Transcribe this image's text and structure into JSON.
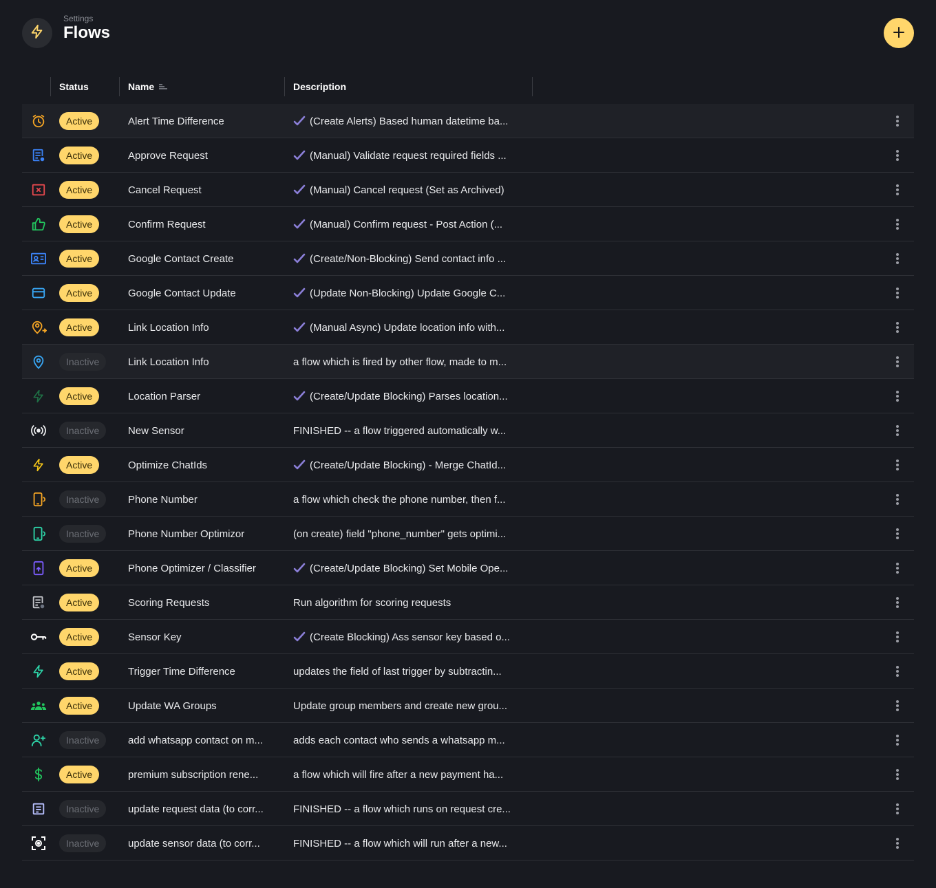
{
  "header": {
    "subtitle": "Settings",
    "title": "Flows",
    "icon": "bolt-icon",
    "add_button_icon": "plus-icon"
  },
  "columns": {
    "status": "Status",
    "name": "Name",
    "description": "Description"
  },
  "colors": {
    "accent": "#ffd66b",
    "background": "#181a20",
    "check": "#8b7fd8"
  },
  "rows": [
    {
      "icon": "alarm-clock-icon",
      "icon_color": "#f5a524",
      "status": "Active",
      "name": "Alert Time Difference",
      "desc": "(Create Alerts) Based human datetime ba...",
      "checked": true,
      "highlight": true
    },
    {
      "icon": "document-check-icon",
      "icon_color": "#3b82f6",
      "status": "Active",
      "name": "Approve Request",
      "desc": "(Manual) Validate request required fields ...",
      "checked": true
    },
    {
      "icon": "close-box-icon",
      "icon_color": "#e5484d",
      "status": "Active",
      "name": "Cancel Request",
      "desc": "(Manual) Cancel request (Set as Archived)",
      "checked": true
    },
    {
      "icon": "thumbs-up-icon",
      "icon_color": "#22c55e",
      "status": "Active",
      "name": "Confirm Request",
      "desc": "(Manual) Confirm request - Post Action (...",
      "checked": true
    },
    {
      "icon": "contact-card-icon",
      "icon_color": "#3b82f6",
      "status": "Active",
      "name": "Google Contact Create",
      "desc": "(Create/Non-Blocking) Send contact info ...",
      "checked": true
    },
    {
      "icon": "credit-card-icon",
      "icon_color": "#38a7f5",
      "status": "Active",
      "name": "Google Contact Update",
      "desc": "(Update Non-Blocking) Update Google C...",
      "checked": true
    },
    {
      "icon": "location-user-icon",
      "icon_color": "#f5a524",
      "status": "Active",
      "name": "Link Location Info",
      "desc": "(Manual Async) Update location info with...",
      "checked": true
    },
    {
      "icon": "map-pin-icon",
      "icon_color": "#38a7f5",
      "status": "Inactive",
      "name": "Link Location Info",
      "desc": "a flow which is fired by other flow, made to m...",
      "checked": false,
      "highlight": true
    },
    {
      "icon": "bolt-icon",
      "icon_color": "#1f6f45",
      "status": "Active",
      "name": "Location Parser",
      "desc": "(Create/Update Blocking) Parses location...",
      "checked": true
    },
    {
      "icon": "broadcast-icon",
      "icon_color": "#e9eaec",
      "status": "Inactive",
      "name": "New Sensor",
      "desc": "FINISHED -- a flow triggered automatically w...",
      "checked": false
    },
    {
      "icon": "bolt-icon",
      "icon_color": "#f5c518",
      "status": "Active",
      "name": "Optimize ChatIds",
      "desc": "(Create/Update Blocking) - Merge ChatId...",
      "checked": true
    },
    {
      "icon": "phone-ring-icon",
      "icon_color": "#f5a524",
      "status": "Inactive",
      "name": "Phone Number",
      "desc": "a flow which check the phone number, then f...",
      "checked": false
    },
    {
      "icon": "phone-ring-icon",
      "icon_color": "#2dd4a8",
      "status": "Inactive",
      "name": "Phone Number Optimizor",
      "desc": "(on create) field \"phone_number\" gets optimi...",
      "checked": false
    },
    {
      "icon": "phone-sync-icon",
      "icon_color": "#7c5cff",
      "status": "Active",
      "name": "Phone Optimizer / Classifier",
      "desc": "(Create/Update Blocking) Set Mobile Ope...",
      "checked": true
    },
    {
      "icon": "document-info-icon",
      "icon_color": "#c5c7cc",
      "status": "Active",
      "name": "Scoring Requests",
      "desc": "Run algorithm for scoring requests",
      "checked": false
    },
    {
      "icon": "key-icon",
      "icon_color": "#ffffff",
      "status": "Active",
      "name": "Sensor Key",
      "desc": "(Create Blocking) Ass sensor key based o...",
      "checked": true
    },
    {
      "icon": "bolt-icon",
      "icon_color": "#2dd4a8",
      "status": "Active",
      "name": "Trigger Time Difference",
      "desc": "updates the field of last trigger by subtractin...",
      "checked": false
    },
    {
      "icon": "group-icon",
      "icon_color": "#22c55e",
      "status": "Active",
      "name": "Update WA Groups",
      "desc": "Update group members and create new grou...",
      "checked": false
    },
    {
      "icon": "user-plus-icon",
      "icon_color": "#2dd4a8",
      "status": "Inactive",
      "name": "add whatsapp contact on m...",
      "desc": "adds each contact who sends a whatsapp m...",
      "checked": false
    },
    {
      "icon": "dollar-icon",
      "icon_color": "#22c55e",
      "status": "Active",
      "name": "premium subscription rene...",
      "desc": "a flow which will fire after a new payment ha...",
      "checked": false
    },
    {
      "icon": "document-lines-icon",
      "icon_color": "#b8c0ff",
      "status": "Inactive",
      "name": "update request data (to corr...",
      "desc": "FINISHED -- a flow which runs on request cre...",
      "checked": false
    },
    {
      "icon": "scan-face-icon",
      "icon_color": "#ffffff",
      "status": "Inactive",
      "name": "update sensor data (to corr...",
      "desc": "FINISHED -- a flow which will run after a new...",
      "checked": false
    }
  ]
}
